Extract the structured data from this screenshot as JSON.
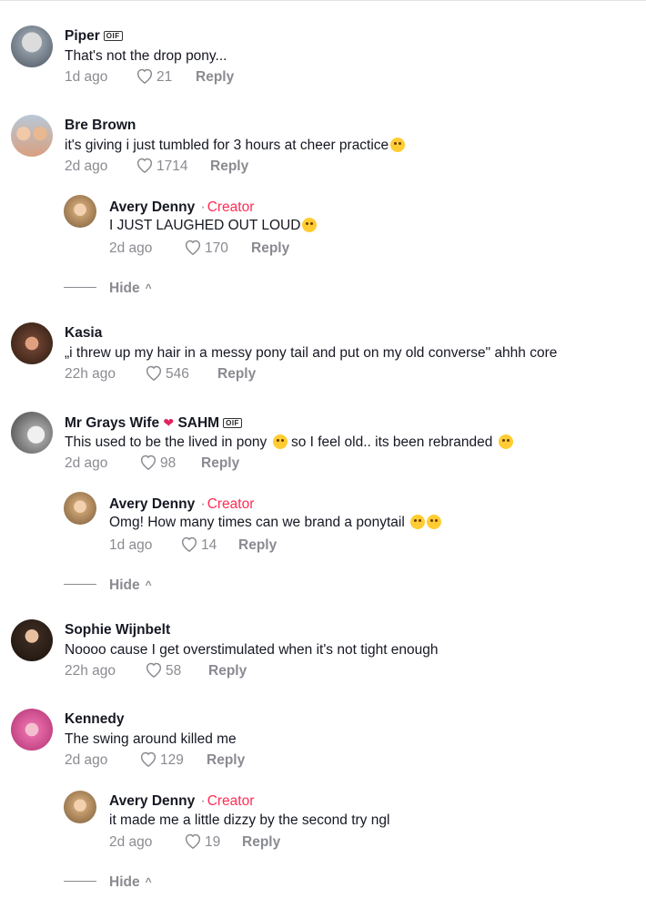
{
  "comments": [
    {
      "name": "Piper",
      "badge": "OIF\nAB4",
      "text": "That's not the drop pony...",
      "time": "1d ago",
      "likes": "21",
      "reply": "Reply",
      "avatar_color": "#8f9aa5"
    },
    {
      "name": "Bre Brown",
      "text": "it's giving i just tumbled for 3 hours at cheer practice",
      "time": "2d ago",
      "likes": "1714",
      "reply": "Reply",
      "avatar_color": "#d8a080"
    },
    {
      "name": "Kasia",
      "text": "„i threw up my hair in a messy pony tail and put on my old converse\" ahhh core",
      "time": "22h ago",
      "likes": "546",
      "reply": "Reply",
      "avatar_color": "#6a4030"
    },
    {
      "name": "Mr Grays Wife",
      "name_suffix": "SAHM",
      "badge": "OIF\nABA",
      "text_part1": "This used to be the lived in pony",
      "text_part2": "so I feel old.. its been rebranded",
      "time": "2d ago",
      "likes": "98",
      "reply": "Reply",
      "avatar_color": "#a0a0a0"
    },
    {
      "name": "Sophie Wijnbelt",
      "text": "Noooo cause I get overstimulated when it's not tight enough",
      "time": "22h ago",
      "likes": "58",
      "reply": "Reply",
      "avatar_color": "#3a2a20"
    },
    {
      "name": "Kennedy",
      "text": "The swing around killed me",
      "time": "2d ago",
      "likes": "129",
      "reply": "Reply",
      "avatar_color": "#e56aa8"
    }
  ],
  "replies": [
    {
      "name": "Avery Denny",
      "creator": "Creator",
      "dot": "·",
      "text": "I JUST LAUGHED OUT LOUD",
      "time": "2d ago",
      "likes": "170",
      "reply": "Reply",
      "hide": "Hide",
      "avatar_color": "#c8a070"
    },
    {
      "name": "Avery Denny",
      "creator": "Creator",
      "dot": "·",
      "text": "Omg! How many times can we brand a ponytail",
      "time": "1d ago",
      "likes": "14",
      "reply": "Reply",
      "hide": "Hide",
      "avatar_color": "#c8a070"
    },
    {
      "name": "Avery Denny",
      "creator": "Creator",
      "dot": "·",
      "text": "it made me a little dizzy by the second try ngl",
      "time": "2d ago",
      "likes": "19",
      "reply": "Reply",
      "hide": "Hide",
      "avatar_color": "#c8a070"
    }
  ],
  "icons": {
    "like": "heart-outline-icon",
    "hide_chevron": "chevron-up-icon"
  },
  "colors": {
    "creator": "#fe2c55",
    "secondary": "#8a8b91",
    "text": "#161823"
  }
}
